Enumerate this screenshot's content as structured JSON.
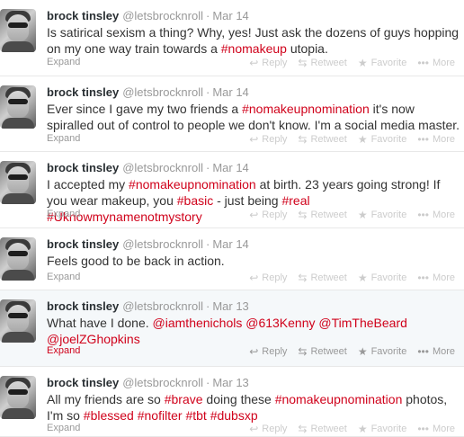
{
  "tweets": [
    {
      "name": "brock tinsley",
      "handle": "@letsbrocknroll",
      "date": "Mar 14",
      "segments": [
        {
          "t": "Is satirical sexism a thing? Why, yes! Just ask the dozens of guys hopping on my one way train towards a "
        },
        {
          "t": "#nomakeup",
          "c": "tag"
        },
        {
          "t": " utopia."
        }
      ],
      "expand": "Expand"
    },
    {
      "name": "brock tinsley",
      "handle": "@letsbrocknroll",
      "date": "Mar 14",
      "segments": [
        {
          "t": "Ever since I gave my two friends a "
        },
        {
          "t": "#nomakeupnomination",
          "c": "tag"
        },
        {
          "t": " it's now spiralled out of control to people we don't know. I'm a social media master."
        }
      ],
      "expand": "Expand"
    },
    {
      "name": "brock tinsley",
      "handle": "@letsbrocknroll",
      "date": "Mar 14",
      "segments": [
        {
          "t": "I accepted my "
        },
        {
          "t": "#nomakeupnomination",
          "c": "tag"
        },
        {
          "t": " at birth. 23 years going strong! If you wear makeup, you "
        },
        {
          "t": "#basic",
          "c": "tag"
        },
        {
          "t": " - just being "
        },
        {
          "t": "#real",
          "c": "tag"
        },
        {
          "t": " "
        },
        {
          "t": "#Uknowmynamenotmystory",
          "c": "tag"
        }
      ],
      "expand": "Expand"
    },
    {
      "name": "brock tinsley",
      "handle": "@letsbrocknroll",
      "date": "Mar 14",
      "segments": [
        {
          "t": "Feels good to be back in action."
        }
      ],
      "expand": "Expand"
    },
    {
      "name": "brock tinsley",
      "handle": "@letsbrocknroll",
      "date": "Mar 13",
      "segments": [
        {
          "t": "What have I done. "
        },
        {
          "t": "@iamthenichols",
          "c": "mention"
        },
        {
          "t": " "
        },
        {
          "t": "@613Kenny",
          "c": "mention"
        },
        {
          "t": " "
        },
        {
          "t": "@TimTheBeard",
          "c": "mention"
        },
        {
          "t": " "
        },
        {
          "t": "@joelZGhopkins",
          "c": "mention"
        }
      ],
      "expand": "Expand"
    },
    {
      "name": "brock tinsley",
      "handle": "@letsbrocknroll",
      "date": "Mar 13",
      "segments": [
        {
          "t": "All my friends are so "
        },
        {
          "t": "#brave",
          "c": "tag"
        },
        {
          "t": " doing these "
        },
        {
          "t": "#nomakeupnomination",
          "c": "tag"
        },
        {
          "t": " photos, I'm so "
        },
        {
          "t": "#blessed",
          "c": "tag"
        },
        {
          "t": " "
        },
        {
          "t": "#nofilter",
          "c": "tag"
        },
        {
          "t": " "
        },
        {
          "t": "#tbt",
          "c": "tag"
        },
        {
          "t": " "
        },
        {
          "t": "#dubsxp",
          "c": "tag"
        }
      ],
      "expand": "Expand"
    }
  ],
  "actions": {
    "reply": "Reply",
    "retweet": "Retweet",
    "favorite": "Favorite",
    "more": "More"
  },
  "icons": {
    "reply": "reply-arrow-icon",
    "retweet": "retweet-icon",
    "favorite": "star-icon",
    "more": "ellipsis-icon"
  },
  "colors": {
    "accent": "#d0021b",
    "meta": "#999999",
    "highlight_bg": "#f5f8fa"
  }
}
